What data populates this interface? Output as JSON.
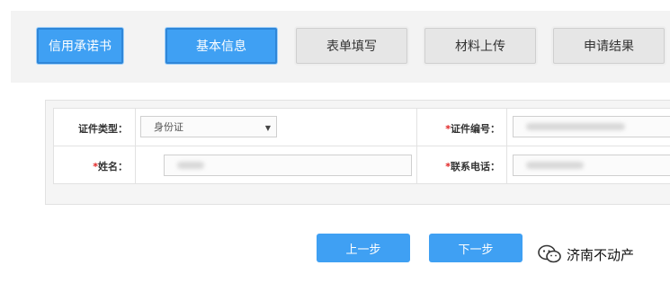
{
  "steps": [
    {
      "label": "信用承诺书",
      "state": "active"
    },
    {
      "label": "基本信息",
      "state": "active"
    },
    {
      "label": "表单填写",
      "state": "inactive"
    },
    {
      "label": "材料上传",
      "state": "inactive"
    },
    {
      "label": "申请结果",
      "state": "inactive"
    }
  ],
  "form": {
    "id_type_label": "证件类型：",
    "id_type_value": "身份证",
    "id_number_label": "证件编号：",
    "id_number_value": "",
    "name_label": "姓名：",
    "name_value": "",
    "phone_label": "联系电话：",
    "phone_value": "",
    "required_mark": "*"
  },
  "buttons": {
    "prev": "上一步",
    "next": "下一步"
  },
  "watermark": {
    "text": "济南不动产",
    "icon": "wechat-icon"
  },
  "colors": {
    "accent": "#3fa0f3",
    "required": "#e02020"
  }
}
